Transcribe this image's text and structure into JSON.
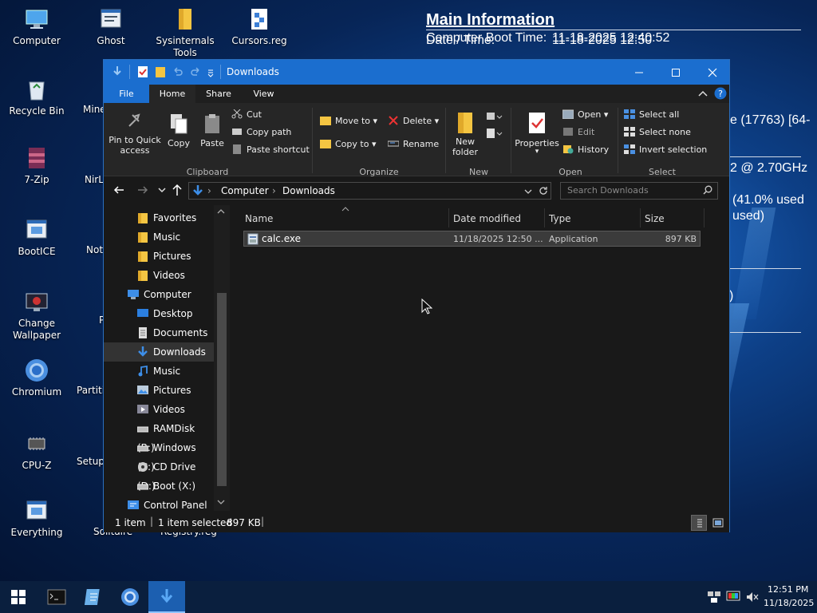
{
  "desktop": {
    "icons": [
      {
        "label": "Computer",
        "name": "computer"
      },
      {
        "label": "Ghost",
        "name": "ghost"
      },
      {
        "label": "Sysinternals Tools",
        "name": "sysinternals-tools"
      },
      {
        "label": "Cursors.reg",
        "name": "cursors-reg"
      },
      {
        "label": "Recycle Bin",
        "name": "recycle-bin"
      },
      {
        "label": "7-Zip",
        "name": "7-zip"
      },
      {
        "label": "BootICE",
        "name": "bootice"
      },
      {
        "label": "Change Wallpaper",
        "name": "change-wallpaper"
      },
      {
        "label": "Chromium",
        "name": "chromium"
      },
      {
        "label": "CPU-Z",
        "name": "cpu-z"
      },
      {
        "label": "Everything",
        "name": "everything"
      }
    ],
    "partial_labels": [
      "Mine",
      "NirL",
      "Not",
      "P",
      "Partiti",
      "Setup",
      "Solitaire",
      "Registry.reg"
    ]
  },
  "bginfo": {
    "title": "Main Information",
    "rows": [
      {
        "key": "Date / Time:",
        "value": "11-18-2025 12:50"
      },
      {
        "key": "Computer Boot Time:",
        "value": "11-18-2025 12:40:52"
      }
    ],
    "side_texts": [
      "e (17763) [64-",
      "2 @ 2.70GHz",
      "(41.0% used",
      "used)",
      ")"
    ]
  },
  "window": {
    "title": "Downloads",
    "tabs": [
      "File",
      "Home",
      "Share",
      "View"
    ],
    "ribbon": {
      "clipboard": {
        "pin": "Pin to Quick access",
        "copy": "Copy",
        "paste": "Paste",
        "cut": "Cut",
        "copy_path": "Copy path",
        "paste_shortcut": "Paste shortcut",
        "group": "Clipboard"
      },
      "organize": {
        "move_to": "Move to",
        "copy_to": "Copy to",
        "delete": "Delete",
        "rename": "Rename",
        "group": "Organize"
      },
      "new": {
        "new_folder": "New folder",
        "group": "New"
      },
      "open": {
        "properties": "Properties",
        "open": "Open",
        "edit": "Edit",
        "history": "History",
        "group": "Open"
      },
      "select": {
        "select_all": "Select all",
        "select_none": "Select none",
        "invert": "Invert selection",
        "group": "Select"
      }
    },
    "address": {
      "crumbs": [
        "Computer",
        "Downloads"
      ],
      "search_placeholder": "Search Downloads"
    },
    "nav": [
      {
        "label": "Favorites",
        "icon": "folder"
      },
      {
        "label": "Music",
        "icon": "folder"
      },
      {
        "label": "Pictures",
        "icon": "folder"
      },
      {
        "label": "Videos",
        "icon": "folder"
      },
      {
        "label": "Computer",
        "icon": "computer"
      },
      {
        "label": "Desktop",
        "icon": "desktop"
      },
      {
        "label": "Documents",
        "icon": "documents"
      },
      {
        "label": "Downloads",
        "icon": "downloads"
      },
      {
        "label": "Music",
        "icon": "music"
      },
      {
        "label": "Pictures",
        "icon": "pictures"
      },
      {
        "label": "Videos",
        "icon": "videos"
      },
      {
        "label": "RAMDisk (B:)",
        "icon": "drive"
      },
      {
        "label": "Windows (C:)",
        "icon": "drive"
      },
      {
        "label": "CD Drive (D:)",
        "icon": "cd-drive"
      },
      {
        "label": "Boot (X:)",
        "icon": "drive"
      },
      {
        "label": "Control Panel",
        "icon": "control-panel"
      }
    ],
    "columns": [
      "Name",
      "Date modified",
      "Type",
      "Size"
    ],
    "files": [
      {
        "name": "calc.exe",
        "date": "11/18/2025 12:50 ...",
        "type": "Application",
        "size": "897 KB"
      }
    ],
    "status": {
      "count": "1 item",
      "selected": "1 item selected",
      "size": "897 KB"
    }
  },
  "taskbar": {
    "time": "12:51 PM",
    "date": "11/18/2025"
  },
  "colors": {
    "titlebar": "#1b6ecf",
    "selection": "#3b3b3b",
    "accent": "#0078d7"
  }
}
